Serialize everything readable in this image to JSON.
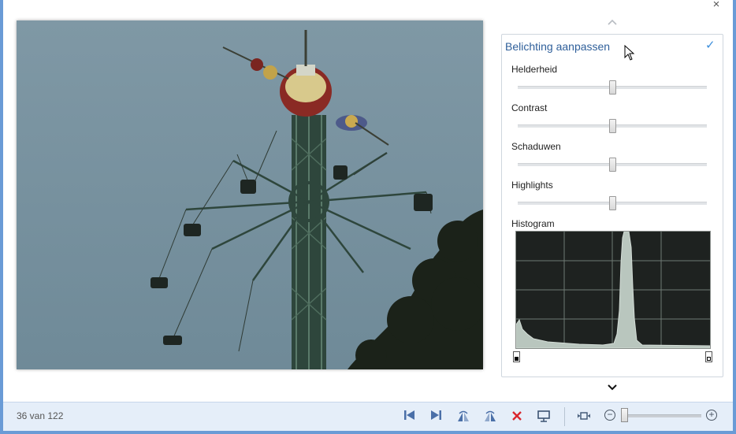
{
  "window": {
    "close_glyph": "×"
  },
  "photo": {
    "description_icon": "photo-image"
  },
  "panel": {
    "chevron_up": "^",
    "title": "Belichting aanpassen",
    "confirm_glyph": "✓",
    "sliders": [
      {
        "label": "Helderheid",
        "value": 0.5
      },
      {
        "label": "Contrast",
        "value": 0.5
      },
      {
        "label": "Schaduwen",
        "value": 0.5
      },
      {
        "label": "Highlights",
        "value": 0.5
      }
    ],
    "histogram": {
      "label": "Histogram"
    },
    "chevron_down": "⌄"
  },
  "statusbar": {
    "counter": "36 van 122",
    "zoom_level": 0.05,
    "zoom_out_glyph": "−",
    "zoom_in_glyph": "+"
  },
  "toolbar_icons": [
    "previous-icon",
    "next-icon",
    "rotate-left-icon",
    "rotate-right-icon",
    "delete-icon",
    "slideshow-icon",
    "fit-to-window-icon"
  ],
  "colors": {
    "accent": "#6a9bd6",
    "title_blue": "#2f5f9a",
    "check_blue": "#3c8edb",
    "delete_red": "#d9262e",
    "bar_bg": "#e5eef9"
  }
}
